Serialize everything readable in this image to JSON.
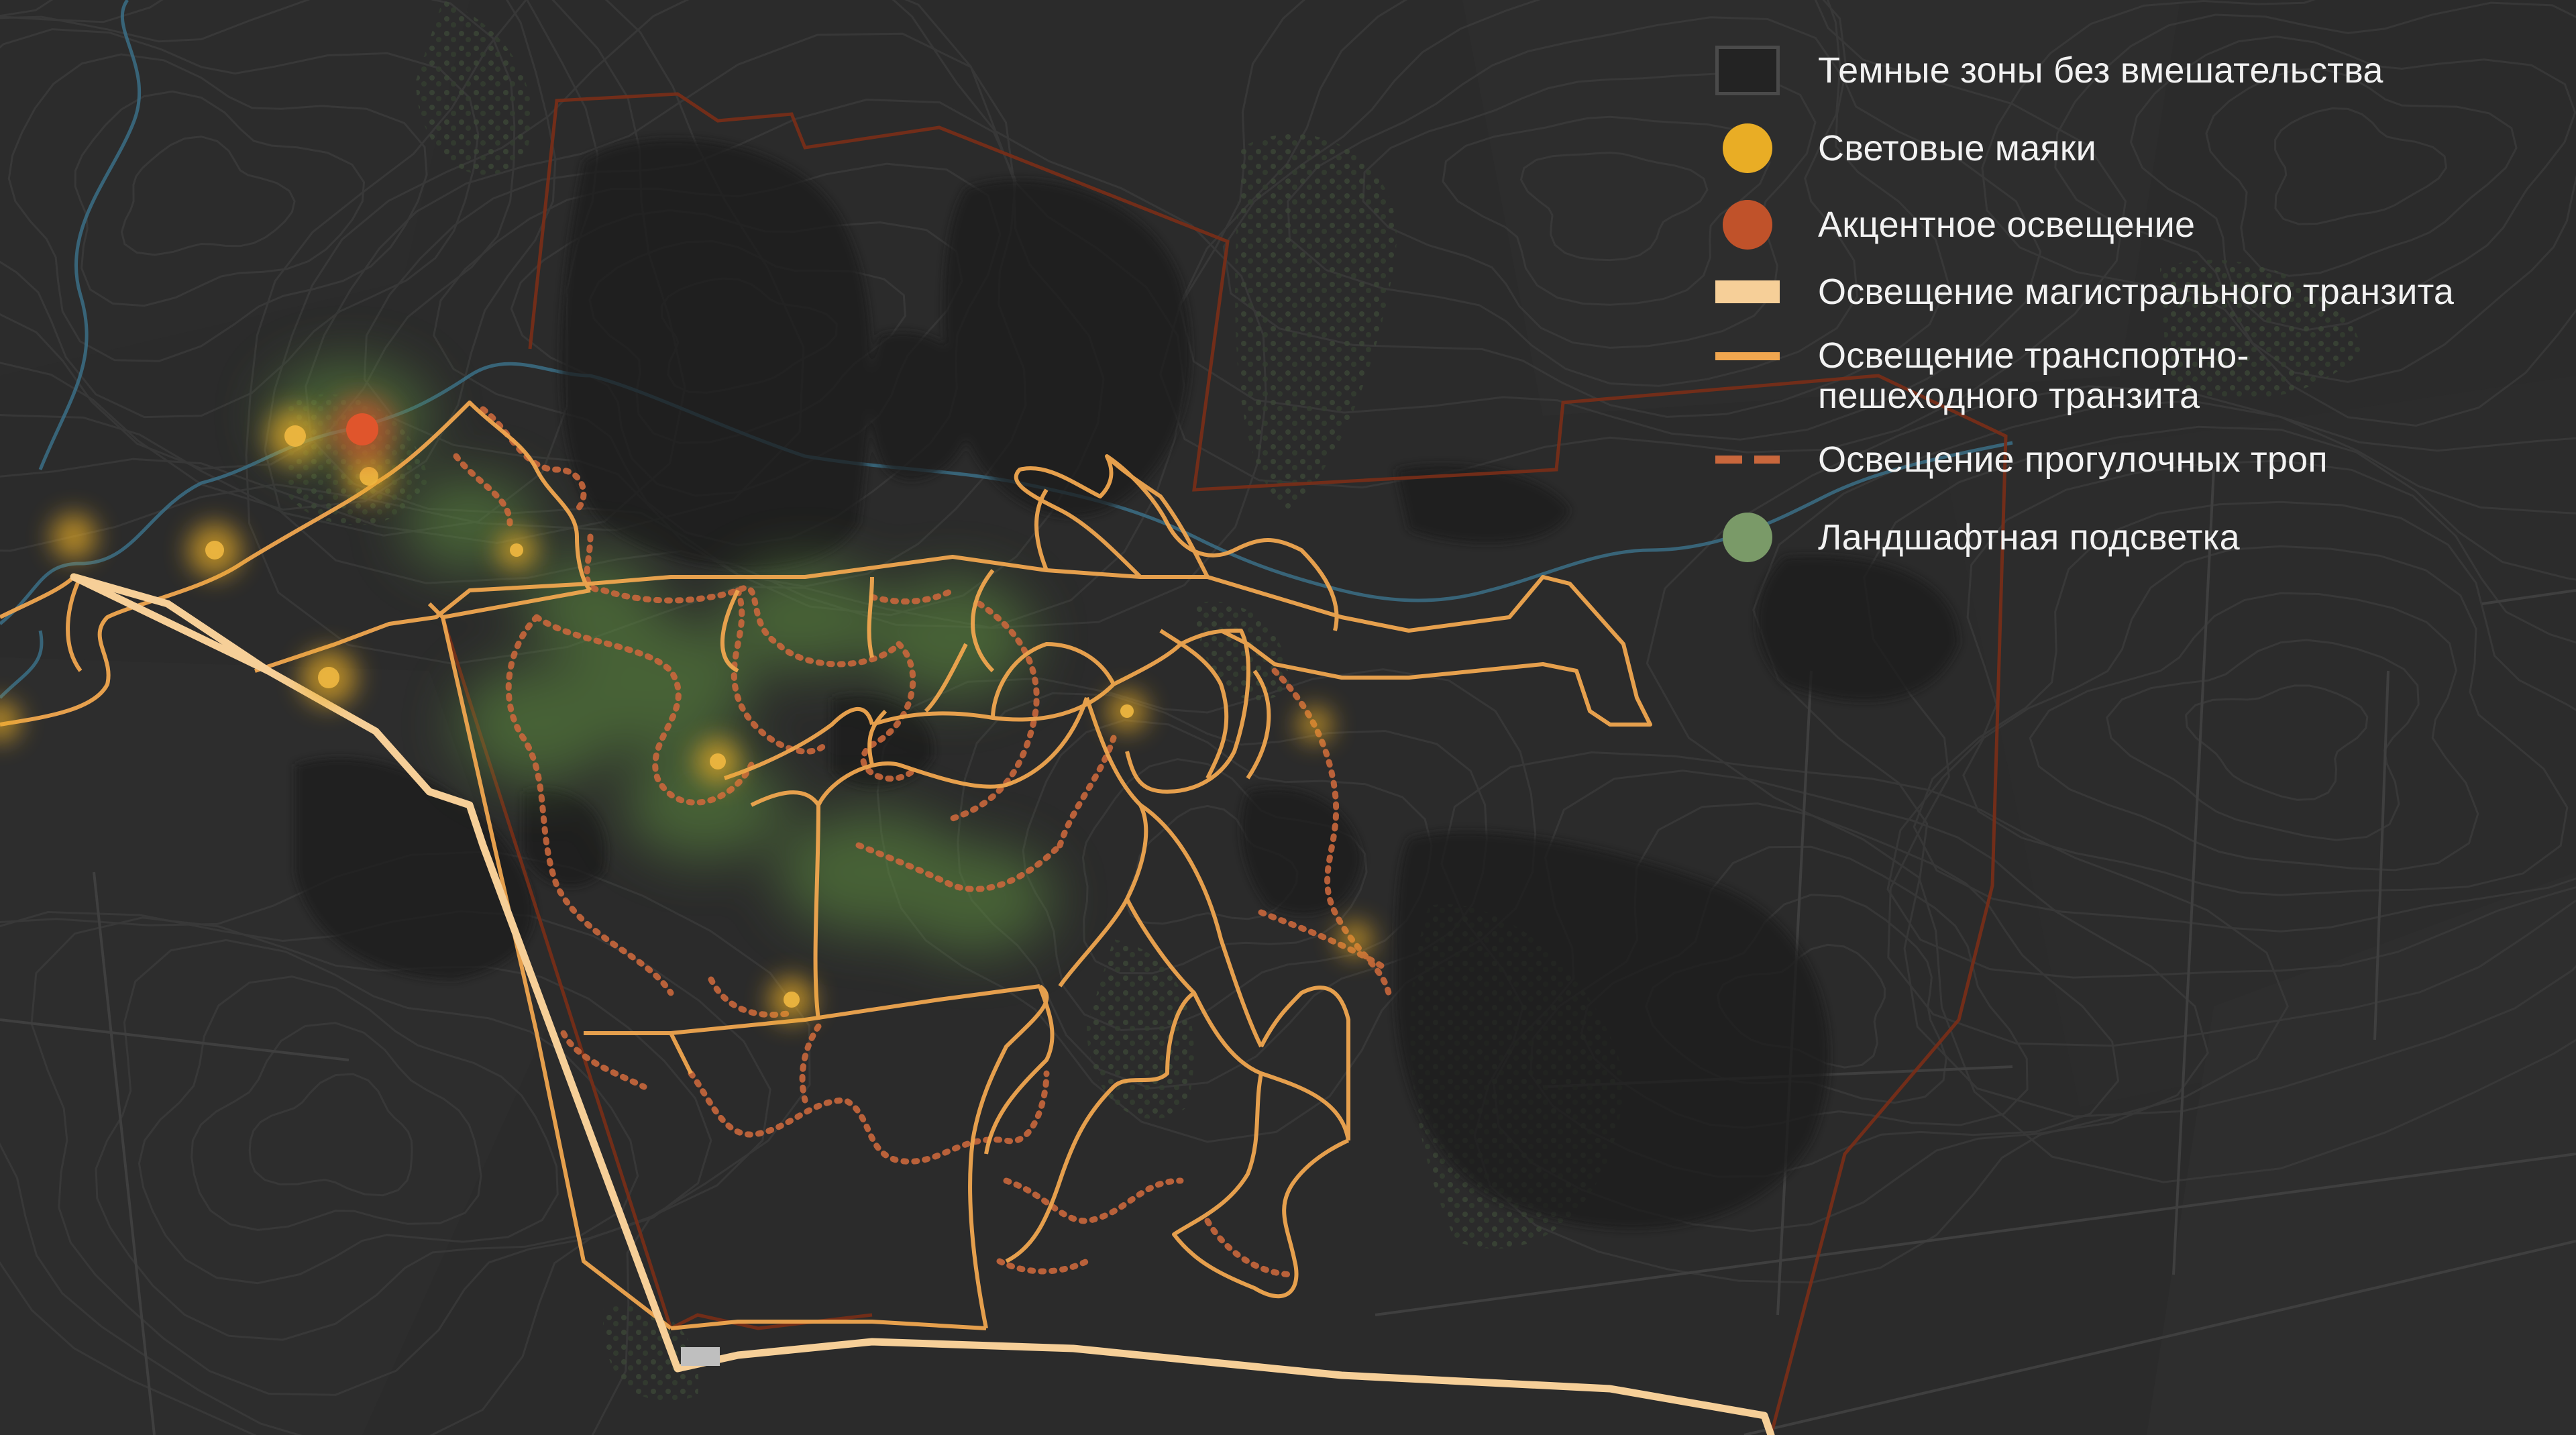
{
  "legend": {
    "items": [
      {
        "label": "Темные зоны без вмешательства",
        "symbol": "dark-zone-square",
        "color": "#232323"
      },
      {
        "label": "Световые маяки",
        "symbol": "light-beacon-dot",
        "color": "#e9ad25"
      },
      {
        "label": "Акцентное освещение",
        "symbol": "accent-light-dot",
        "color": "#c0522a"
      },
      {
        "label": "Освещение магистрального транзита",
        "symbol": "main-transit-line",
        "color": "#f6cf98"
      },
      {
        "label": "Освещение транспортно-\nпешеходного транзита",
        "label_line1": "Освещение транспортно-",
        "label_line2": "пешеходного транзита",
        "symbol": "pedestrian-transit-line",
        "color": "#f0a64f"
      },
      {
        "label": "Освещение прогулочных троп",
        "symbol": "walking-trail-dashed-line",
        "color": "#c9673c"
      },
      {
        "label": "Ландшафтная подсветка",
        "symbol": "landscape-light-dot",
        "color": "#7a9a68"
      }
    ]
  },
  "map": {
    "colors": {
      "background": "#2b2b2b",
      "dark_zone": "#1c1c1c",
      "contour": "#3a3a3a",
      "river": "#3b6f86",
      "forest": "#2f3a2b",
      "boundary": "#7a2e17",
      "main_transit": "#f6cf98",
      "pedestrian_transit": "#f0a64f",
      "walking_trail": "#c9673c",
      "beacon": "#e9ad25",
      "accent": "#e0552c",
      "landscape": "#5f8f3f"
    }
  }
}
